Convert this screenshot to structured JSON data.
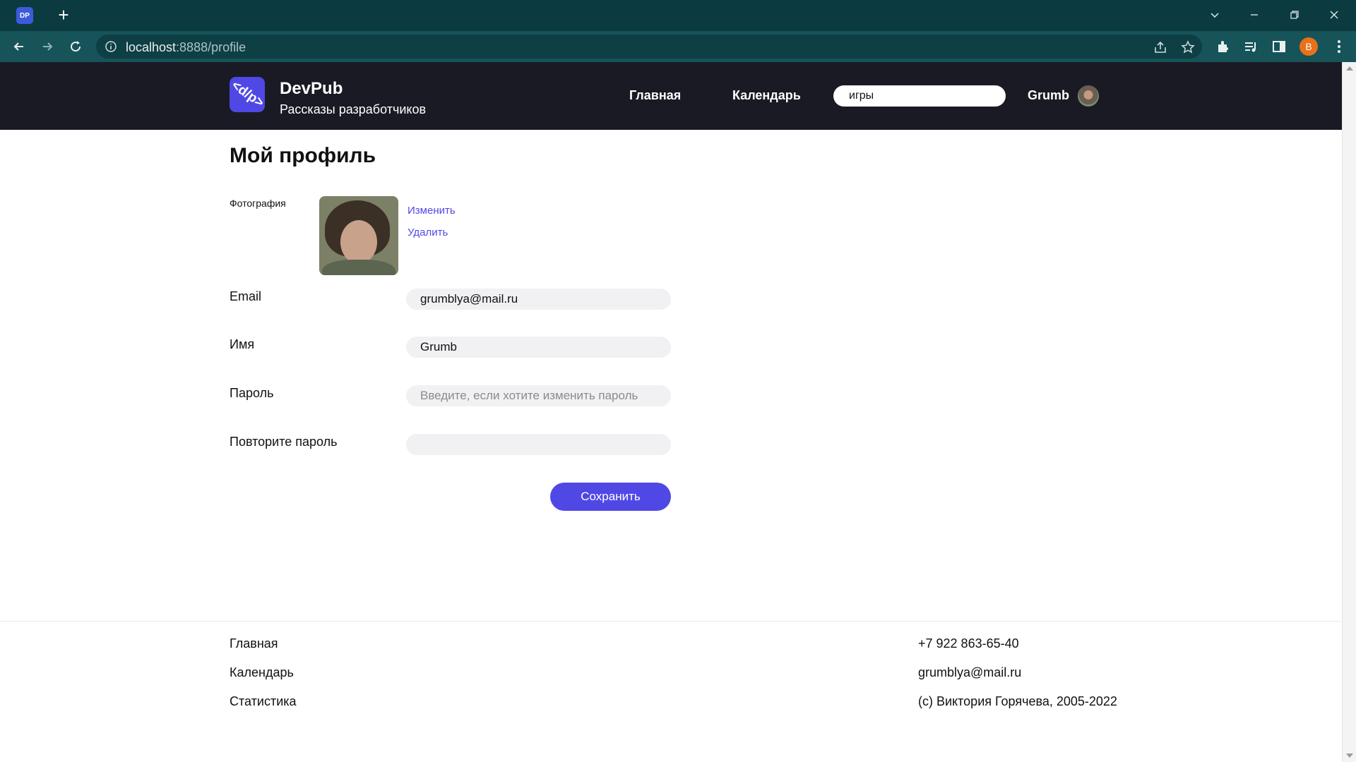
{
  "browser": {
    "tab_favicon_text": "DP",
    "new_tab": "+",
    "url_host": "localhost",
    "url_rest": ":8888/profile",
    "profile_initial": "B"
  },
  "header": {
    "logo_text": "<d/p>",
    "brand_name": "DevPub",
    "brand_tagline": "Рассказы разработчиков",
    "nav": {
      "home": "Главная",
      "calendar": "Календарь"
    },
    "search_value": "игры",
    "username": "Grumb"
  },
  "profile": {
    "title": "Мой профиль",
    "photo_label": "Фотография",
    "photo_change": "Изменить",
    "photo_delete": "Удалить",
    "email_label": "Email",
    "email_value": "grumblya@mail.ru",
    "name_label": "Имя",
    "name_value": "Grumb",
    "password_label": "Пароль",
    "password_placeholder": "Введите, если хотите изменить пароль",
    "password_repeat_label": "Повторите пароль",
    "password_repeat_value": "",
    "save_label": "Сохранить"
  },
  "footer": {
    "links": [
      "Главная",
      "Календарь",
      "Статистика"
    ],
    "phone": "+7 922 863-65-40",
    "email": "grumblya@mail.ru",
    "copyright": "(c) Виктория Горячева, 2005-2022"
  },
  "colors": {
    "accent": "#5048e5",
    "header_bg": "#1a1a24",
    "chrome_tabbar": "#0b3b40",
    "chrome_toolbar": "#16545a"
  }
}
